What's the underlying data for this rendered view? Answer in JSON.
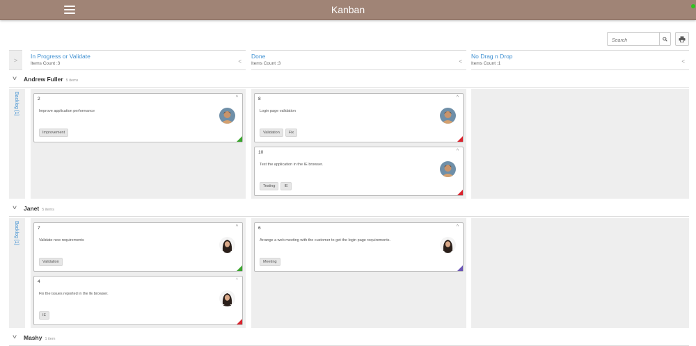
{
  "app": {
    "title": "Kanban"
  },
  "toolbar": {
    "search_placeholder": "Search"
  },
  "columns": [
    {
      "title": "In Progress or Validate",
      "count": "Items Count :3"
    },
    {
      "title": "Done",
      "count": "Items Count :3"
    },
    {
      "title": "No Drag n Drop",
      "count": "Items Count :1"
    }
  ],
  "swimlanes": [
    {
      "name": "Andrew Fuller",
      "count": "5 items",
      "backlog": "Backlog [1]"
    },
    {
      "name": "Janet",
      "count": "5 items",
      "backlog": "Backlog [1]"
    },
    {
      "name": "Mashy",
      "count": "1 item"
    }
  ],
  "cards": [
    {
      "id": "2",
      "text": "Improve application performance",
      "tags": [
        "Improvement"
      ],
      "priority_color": "#3aa52d",
      "avatar": "man"
    },
    {
      "id": "8",
      "text": "Login page validation",
      "tags": [
        "Validation",
        "Fix"
      ],
      "priority_color": "#d9232d",
      "avatar": "man"
    },
    {
      "id": "10",
      "text": "Test the application in the IE browser.",
      "tags": [
        "Testing",
        "IE"
      ],
      "priority_color": "#d9232d",
      "avatar": "man"
    },
    {
      "id": "7",
      "text": "Validate new requirements",
      "tags": [
        "Validation"
      ],
      "priority_color": "#3aa52d",
      "avatar": "woman"
    },
    {
      "id": "6",
      "text": "Arrange a web meeting with the customer to get the login page requirements.",
      "tags": [
        "Meeting"
      ],
      "priority_color": "#6b55b5",
      "avatar": "woman"
    },
    {
      "id": "4",
      "text": "Fix the issues reported in the IE browser.",
      "tags": [
        "IE"
      ],
      "priority_color": "#d9232d",
      "avatar": "woman"
    }
  ]
}
